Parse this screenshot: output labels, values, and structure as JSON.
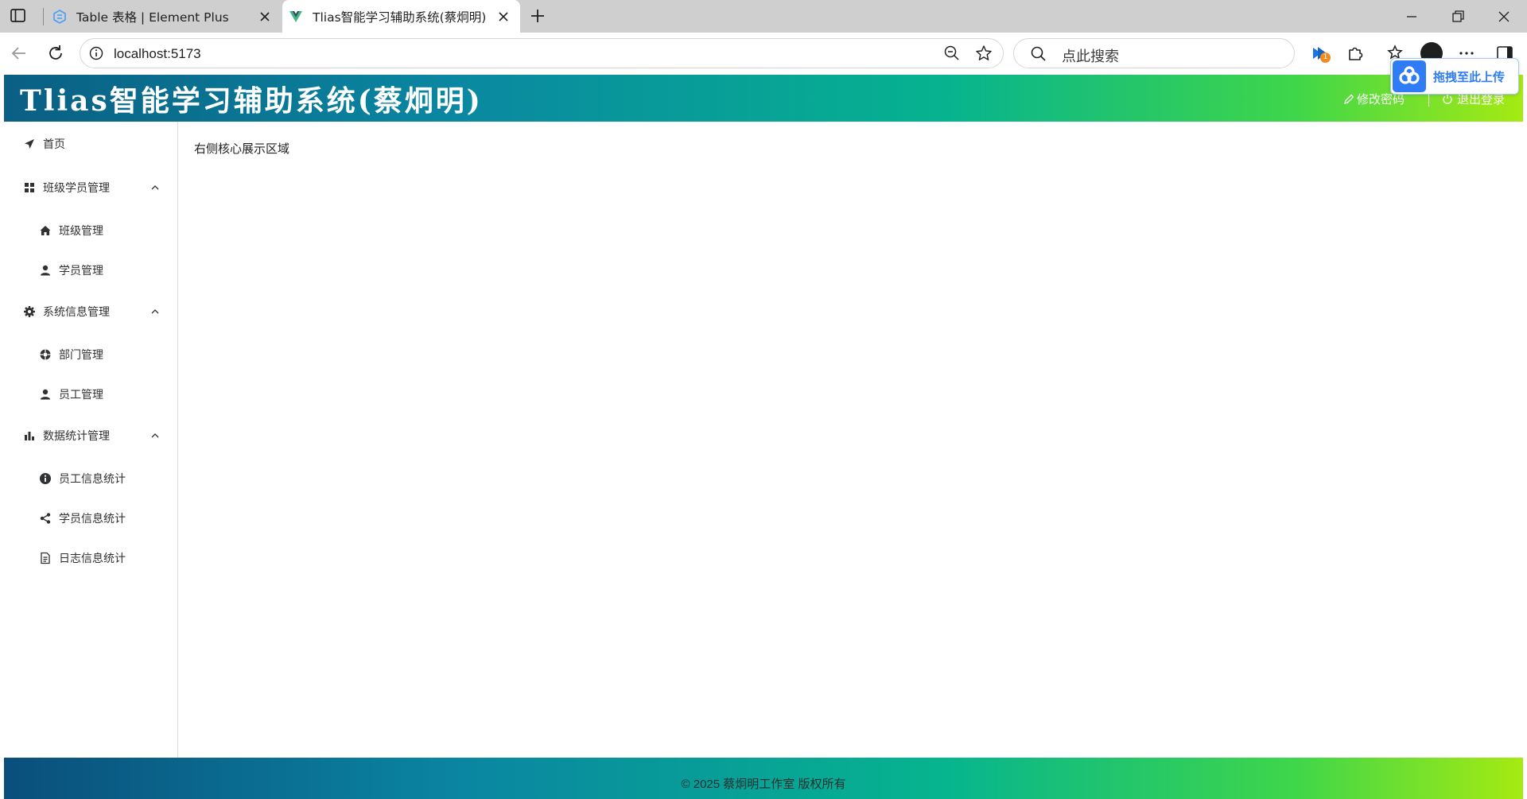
{
  "browser": {
    "tabs": [
      {
        "title": "Table 表格 | Element Plus",
        "active": false
      },
      {
        "title": "Tlias智能学习辅助系统(蔡炯明)",
        "active": true
      }
    ],
    "url": "localhost:5173",
    "search_placeholder": "点此搜索",
    "extension_badge": "1"
  },
  "upload_widget": {
    "label": "拖拽至此上传"
  },
  "header": {
    "title": "Tlias智能学习辅助系统(蔡炯明)",
    "change_password": "修改密码",
    "logout": "退出登录",
    "gradient_colors": [
      "#0a5f84",
      "#06b38f",
      "#a6ea12"
    ]
  },
  "sidebar": {
    "home": "首页",
    "groups": [
      {
        "label": "班级学员管理",
        "icon": "grid-icon",
        "items": [
          {
            "label": "班级管理",
            "icon": "home-icon"
          },
          {
            "label": "学员管理",
            "icon": "user-icon"
          }
        ]
      },
      {
        "label": "系统信息管理",
        "icon": "gear-icon",
        "items": [
          {
            "label": "部门管理",
            "icon": "help-circle-icon"
          },
          {
            "label": "员工管理",
            "icon": "user-icon"
          }
        ]
      },
      {
        "label": "数据统计管理",
        "icon": "bar-chart-icon",
        "items": [
          {
            "label": "员工信息统计",
            "icon": "info-icon"
          },
          {
            "label": "学员信息统计",
            "icon": "share-icon"
          },
          {
            "label": "日志信息统计",
            "icon": "document-icon"
          }
        ]
      }
    ]
  },
  "main": {
    "text": "右侧核心展示区域"
  },
  "footer": {
    "text": "© 2025 蔡炯明工作室 版权所有"
  }
}
